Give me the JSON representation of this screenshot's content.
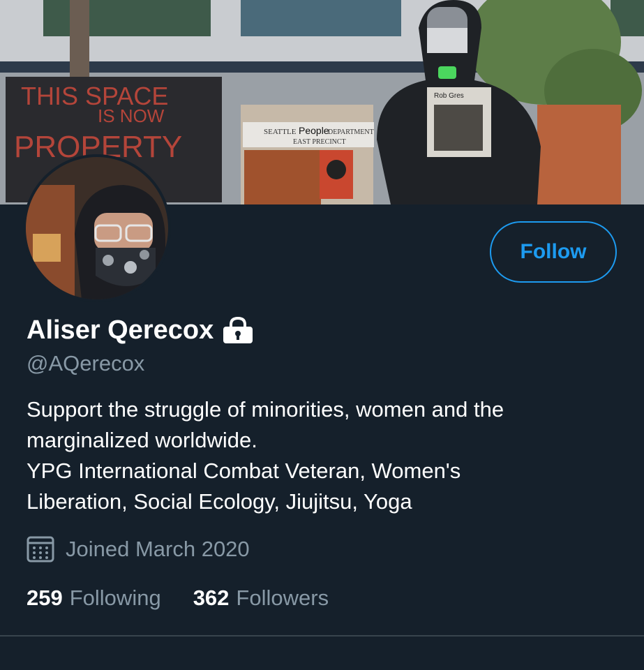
{
  "profile": {
    "display_name": "Aliser Qerecox",
    "handle": "@AQerecox",
    "bio_lines": [
      "Support the struggle of minorities, women and the",
      "marginalized worldwide.",
      "YPG International Combat Veteran, Women's",
      "Liberation, Social Ecology, Jiujitsu, Yoga"
    ],
    "joined": "Joined March 2020",
    "following_count": "259",
    "following_label": "Following",
    "followers_count": "362",
    "followers_label": "Followers",
    "follow_button": "Follow"
  },
  "banner_text": {
    "sign_line1": "THIS SPACE",
    "sign_line2": "IS NOW",
    "sign_line3": "PROPERTY",
    "building_sign_1": "SEATTLE",
    "building_sign_2": "People",
    "building_sign_3": "DEPARTMENT",
    "building_sign_4": "EAST PRECINCT",
    "shirt_text": "Rob Gres"
  },
  "colors": {
    "background": "#15202b",
    "accent": "#1d9bf0",
    "secondary_text": "#8899a6",
    "divider": "#38444d"
  },
  "icons": {
    "lock": "lock-icon",
    "calendar": "calendar-icon"
  }
}
